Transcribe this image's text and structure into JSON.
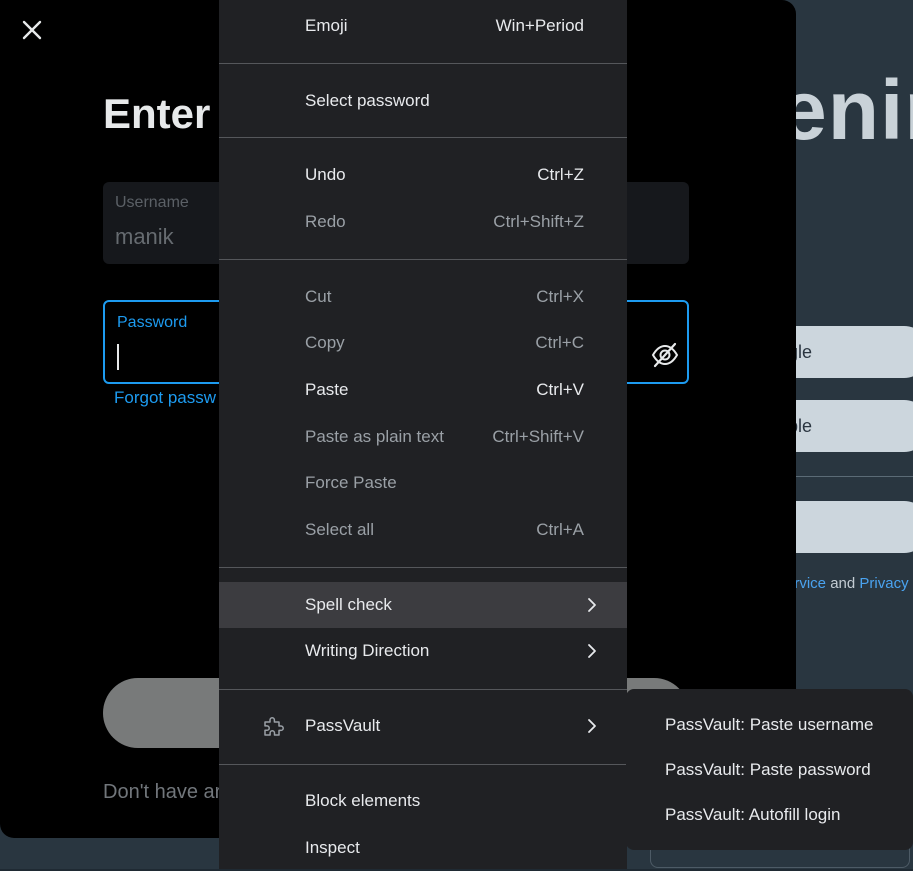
{
  "background": {
    "headline_fragment": "enir",
    "buttons": [
      {
        "label": "gle"
      },
      {
        "label": "ple"
      }
    ],
    "legal": {
      "terms_fragment": "ervice",
      "and": "and",
      "privacy_fragment": "Privacy"
    }
  },
  "modal": {
    "title": "Enter y",
    "username": {
      "label": "Username",
      "value": "manik"
    },
    "password": {
      "label": "Password",
      "value": ""
    },
    "forgot_link": "Forgot passw",
    "signup_text": "Don't have ar"
  },
  "context_menu": {
    "items": [
      {
        "label": "Emoji",
        "shortcut": "Win+Period",
        "enabled": true
      },
      {
        "label": "Select password",
        "shortcut": "",
        "enabled": true
      },
      {
        "label": "Undo",
        "shortcut": "Ctrl+Z",
        "enabled": true
      },
      {
        "label": "Redo",
        "shortcut": "Ctrl+Shift+Z",
        "enabled": false
      },
      {
        "label": "Cut",
        "shortcut": "Ctrl+X",
        "enabled": false
      },
      {
        "label": "Copy",
        "shortcut": "Ctrl+C",
        "enabled": false
      },
      {
        "label": "Paste",
        "shortcut": "Ctrl+V",
        "enabled": true
      },
      {
        "label": "Paste as plain text",
        "shortcut": "Ctrl+Shift+V",
        "enabled": false
      },
      {
        "label": "Force Paste",
        "shortcut": "",
        "enabled": false
      },
      {
        "label": "Select all",
        "shortcut": "Ctrl+A",
        "enabled": false
      },
      {
        "label": "Spell check",
        "shortcut": "",
        "enabled": true,
        "submenu": true,
        "highlighted": true
      },
      {
        "label": "Writing Direction",
        "shortcut": "",
        "enabled": true,
        "submenu": true
      },
      {
        "label": "PassVault",
        "shortcut": "",
        "enabled": true,
        "submenu": true,
        "icon": "puzzle-icon"
      },
      {
        "label": "Block elements",
        "shortcut": "",
        "enabled": true
      },
      {
        "label": "Inspect",
        "shortcut": "",
        "enabled": true
      }
    ]
  },
  "passvault_submenu": {
    "items": [
      {
        "label": "PassVault: Paste username"
      },
      {
        "label": "PassVault: Paste password"
      },
      {
        "label": "PassVault: Autofill login"
      }
    ]
  },
  "icons": {
    "close": "close-icon",
    "eye_toggle": "eye-off-icon",
    "submenu_arrow": "chevron-right-icon",
    "extension": "puzzle-icon"
  },
  "colors": {
    "accent": "#1d9bf0",
    "menu_bg": "#202124",
    "menu_highlight": "#3c3c40",
    "menu_text": "#e8eaed",
    "menu_disabled_text": "#9aa0a6",
    "modal_bg": "#000000"
  }
}
